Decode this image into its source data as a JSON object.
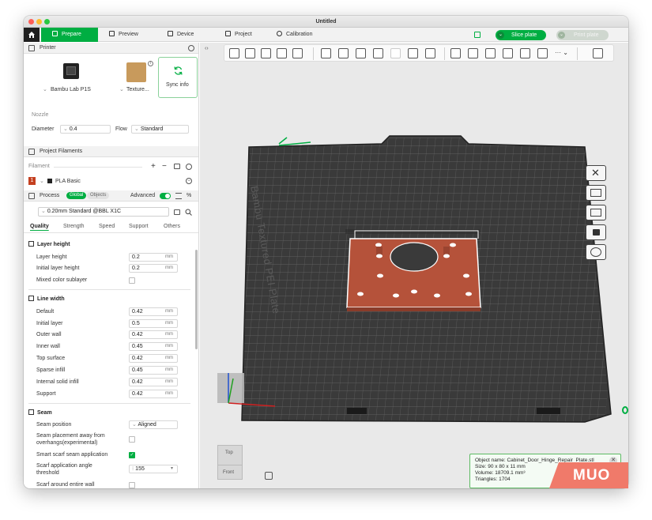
{
  "window": {
    "title": "Untitled"
  },
  "topbar": {
    "tabs": [
      {
        "label": "Prepare",
        "icon": "cube-icon"
      },
      {
        "label": "Preview",
        "icon": "layers-icon"
      },
      {
        "label": "Device",
        "icon": "monitor-icon"
      },
      {
        "label": "Project",
        "icon": "folder-icon"
      },
      {
        "label": "Calibration",
        "icon": "target-icon"
      }
    ],
    "slice_label": "Slice plate",
    "print_label": "Print plate"
  },
  "printer": {
    "section_title": "Printer",
    "printer_name": "Bambu Lab P1S",
    "plate_name": "Texture...",
    "sync_label": "Sync info",
    "nozzle_title": "Nozzle",
    "diameter_label": "Diameter",
    "diameter_value": "0.4",
    "flow_label": "Flow",
    "flow_value": "Standard"
  },
  "filaments": {
    "section_title": "Project Filaments",
    "filament_label": "Filament",
    "items": [
      {
        "index": "1",
        "name": "PLA Basic"
      }
    ]
  },
  "process": {
    "section_title": "Process",
    "global_label": "Global",
    "objects_label": "Objects",
    "advanced_label": "Advanced",
    "preset": "0.20mm Standard @BBL X1C",
    "tabs": [
      "Quality",
      "Strength",
      "Speed",
      "Support",
      "Others"
    ],
    "layer_height": {
      "title": "Layer height",
      "rows": [
        {
          "label": "Layer height",
          "value": "0.2",
          "unit": "mm"
        },
        {
          "label": "Initial layer height",
          "value": "0.2",
          "unit": "mm"
        }
      ],
      "mixed_label": "Mixed color sublayer"
    },
    "line_width": {
      "title": "Line width",
      "rows": [
        {
          "label": "Default",
          "value": "0.42",
          "unit": "mm"
        },
        {
          "label": "Initial layer",
          "value": "0.5",
          "unit": "mm"
        },
        {
          "label": "Outer wall",
          "value": "0.42",
          "unit": "mm"
        },
        {
          "label": "Inner wall",
          "value": "0.45",
          "unit": "mm"
        },
        {
          "label": "Top surface",
          "value": "0.42",
          "unit": "mm"
        },
        {
          "label": "Sparse infill",
          "value": "0.45",
          "unit": "mm"
        },
        {
          "label": "Internal solid infill",
          "value": "0.42",
          "unit": "mm"
        },
        {
          "label": "Support",
          "value": "0.42",
          "unit": "mm"
        }
      ]
    },
    "seam": {
      "title": "Seam",
      "position_label": "Seam position",
      "position_value": "Aligned",
      "placement_label_1": "Seam placement away from",
      "placement_label_2": "overhangs(experimental)",
      "smart_label": "Smart scarf seam application",
      "angle_label_1": "Scarf application angle",
      "angle_label_2": "threshold",
      "angle_value": "155",
      "around_label": "Scarf around entire wall"
    }
  },
  "viewport": {
    "plate_label": "Bambu Textured PEI Plate",
    "nav_cube_top": "Top",
    "nav_cube_front": "Front",
    "object_info": {
      "name": "Object name: Cabinet_Door_Hinge_Repair_Plate.stl",
      "size": "Size: 90 x 80 x 11 mm",
      "volume": "Volume: 18709.1 mm³",
      "triangles": "Triangles: 1704"
    }
  },
  "watermark": "MUO",
  "colors": {
    "accent": "#00ae42",
    "plate": "#3a3a3a",
    "part": "#b5523a"
  }
}
